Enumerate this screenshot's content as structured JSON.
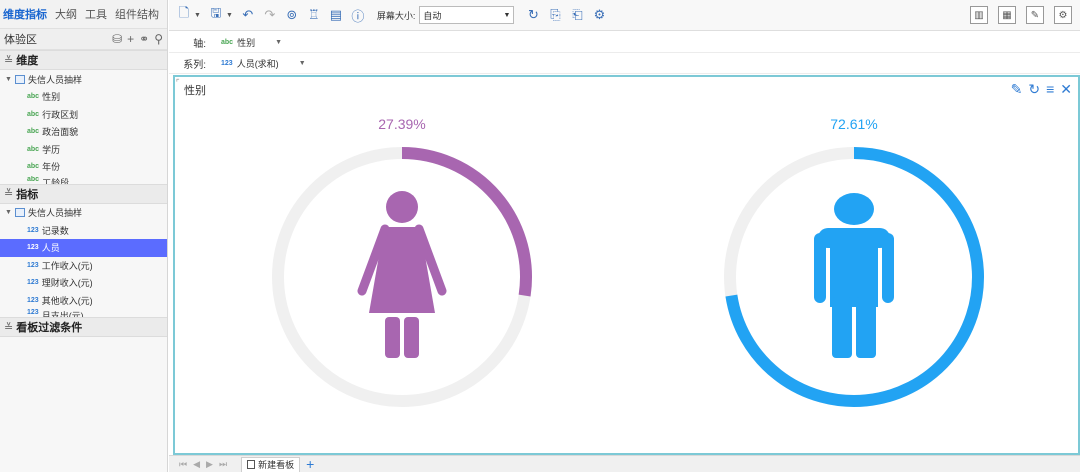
{
  "left_panel": {
    "tabs": [
      "维度指标",
      "大纲",
      "工具",
      "组件结构"
    ],
    "explore": {
      "label": "体验区"
    },
    "dimensions": {
      "title": "维度",
      "root": "失信人员抽样",
      "items": [
        "性别",
        "行政区划",
        "政治面貌",
        "学历",
        "年份",
        "工龄段"
      ]
    },
    "measures": {
      "title": "指标",
      "root": "失信人员抽样",
      "items": [
        "记录数",
        "人员",
        "工作收入(元)",
        "理财收入(元)",
        "其他收入(元)",
        "月支出(元)"
      ],
      "selected_index": 1
    },
    "filters": {
      "title": "看板过滤条件"
    }
  },
  "toolbar": {
    "screen_size_label": "屏幕大小:",
    "screen_size_value": "自动"
  },
  "axis": {
    "label": "轴:",
    "field": "性别",
    "kind": "abc"
  },
  "series": {
    "label": "系列:",
    "field": "人员(求和)",
    "kind": "123"
  },
  "panel": {
    "title": "性别"
  },
  "chart_data": {
    "type": "pie",
    "title": "性别",
    "categories": [
      "女",
      "男"
    ],
    "values": [
      27.39,
      72.61
    ],
    "labels": [
      "27.39%",
      "72.61%"
    ],
    "colors": [
      "#a866b0",
      "#22a3f3"
    ],
    "track_color": "#f0f0f0",
    "icons": [
      "female-figure-icon",
      "male-figure-icon"
    ]
  },
  "bottom": {
    "sheet": "新建看板"
  }
}
